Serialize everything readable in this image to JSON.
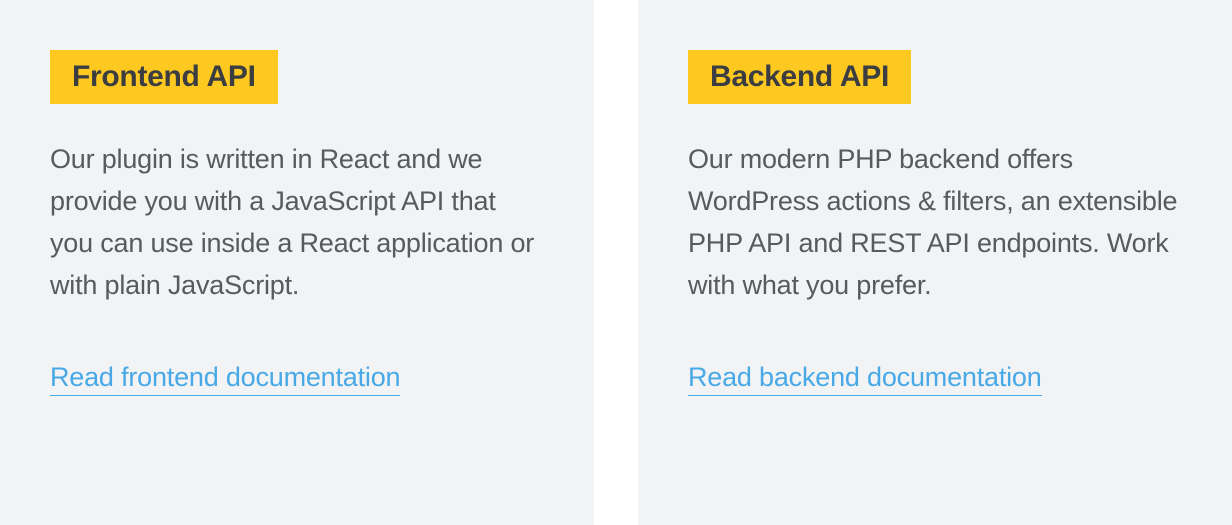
{
  "cards": [
    {
      "title": "Frontend API",
      "body": "Our plugin is written in React and we provide you with a JavaScript API that you can use inside a React application or with plain JavaScript.",
      "link_label": "Read frontend documentation"
    },
    {
      "title": "Backend API",
      "body": "Our modern PHP backend offers WordPress actions & filters, an extensible PHP API and REST API endpoints. Work with what you prefer.",
      "link_label": "Read backend documentation"
    }
  ],
  "colors": {
    "card_bg": "#f1f3f5",
    "title_bg": "#fdc921",
    "title_text": "#3b3d40",
    "body_text": "#575a5e",
    "link": "#48a9e6"
  }
}
